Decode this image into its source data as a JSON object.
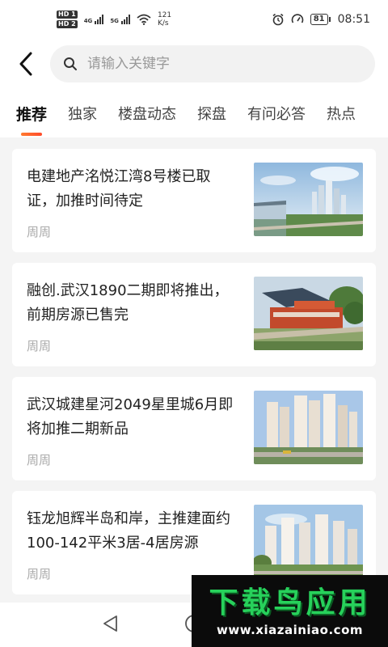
{
  "status_bar": {
    "hd1": "HD 1",
    "hd2": "HD 2",
    "net1": "4G",
    "net2": "5G",
    "speed_value": "121",
    "speed_unit": "K/s",
    "battery": "81",
    "time": "08:51"
  },
  "search": {
    "placeholder": "请输入关键字"
  },
  "tabs": [
    {
      "label": "推荐",
      "active": true
    },
    {
      "label": "独家"
    },
    {
      "label": "楼盘动态"
    },
    {
      "label": "探盘"
    },
    {
      "label": "有问必答"
    },
    {
      "label": "热点"
    }
  ],
  "articles": [
    {
      "title": "电建地产洺悦江湾8号楼已取证，加推时间待定",
      "source": "周周"
    },
    {
      "title": "融创.武汉1890二期即将推出，前期房源已售完",
      "source": "周周"
    },
    {
      "title": "武汉城建星河2049星里城6月即将加推二期新品",
      "source": "周周"
    },
    {
      "title": "钰龙旭辉半岛和岸，主推建面约100-142平米3居-4居房源",
      "source": "周周"
    }
  ],
  "watermark": {
    "title": "下载鸟应用",
    "url": "www.xiazainiao.com"
  },
  "colors": {
    "accent": "#ff5a2c",
    "watermark_green": "#27d15b"
  }
}
